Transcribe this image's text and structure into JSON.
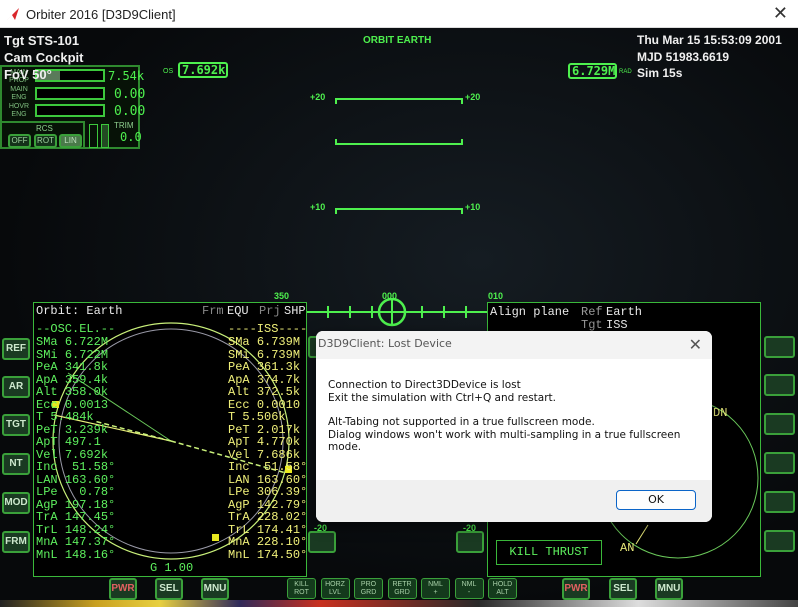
{
  "window": {
    "title": "Orbiter 2016 [D3D9Client]",
    "close": "✕"
  },
  "hud": {
    "target": "Tgt  STS-101",
    "camera": "Cam Cockpit",
    "fov": "FoV  50°",
    "mode": "ORBIT EARTH",
    "os_label": "OS",
    "os_value": "7.692k",
    "rad_value": "6.729M",
    "rad_label": "RAD",
    "date": "Thu Mar 15 15:53:09 2001",
    "mjd": "MJD  51983.6619",
    "sim": "Sim   15s",
    "ladder": [
      "+20",
      "+20",
      "+10",
      "+10",
      "-20",
      "-20"
    ],
    "heading": [
      "350",
      "000",
      "010"
    ]
  },
  "engine_panel": {
    "prop_label": "MAIN PROP",
    "prop_value": "7.54k",
    "prop_fill": 0.35,
    "main_label": "MAIN ENG",
    "main_value": "0.00",
    "hovr_label": "HOVR ENG",
    "hovr_value": "0.00",
    "rcs_label": "RCS",
    "rcs_buttons": [
      "OFF",
      "ROT",
      "LIN"
    ],
    "trim_label": "TRIM",
    "trim_value": "0.0"
  },
  "left_mfd": {
    "title": "Orbit: Earth",
    "frm_label": "Frm",
    "frm": "EQU",
    "prj_label": "Prj",
    "prj": "SHP",
    "left_header": "--OSC.EL.--",
    "right_header": "----ISS----",
    "own": [
      [
        "SMa",
        "6.722M"
      ],
      [
        "SMi",
        "6.722M"
      ],
      [
        "PeA",
        "341.8k"
      ],
      [
        "ApA",
        "359.4k"
      ],
      [
        "Alt",
        "358.0k"
      ],
      [
        "Ecc",
        "0.0013"
      ],
      [
        "T",
        "5.484k"
      ],
      [
        "PeT",
        "3.239k"
      ],
      [
        "ApT",
        "497.1"
      ],
      [
        "Vel",
        "7.692k"
      ],
      [
        "Inc",
        " 51.58°"
      ],
      [
        "LAN",
        "163.60°"
      ],
      [
        "LPe",
        "  0.78°"
      ],
      [
        "AgP",
        "197.18°"
      ],
      [
        "TrA",
        "147.45°"
      ],
      [
        "TrL",
        "148.24°"
      ],
      [
        "MnA",
        "147.37°"
      ],
      [
        "MnL",
        "148.16°"
      ]
    ],
    "target": [
      [
        "SMa",
        "6.739M"
      ],
      [
        "SMi",
        "6.739M"
      ],
      [
        "PeA",
        "361.3k"
      ],
      [
        "ApA",
        "374.7k"
      ],
      [
        "Alt",
        "372.5k"
      ],
      [
        "Ecc",
        "0.0010"
      ],
      [
        "T",
        "5.506k"
      ],
      [
        "PeT",
        "2.017k"
      ],
      [
        "ApT",
        "4.770k"
      ],
      [
        "Vel",
        "7.686k"
      ],
      [
        "Inc",
        " 51.58°"
      ],
      [
        "LAN",
        "163.60°"
      ],
      [
        "LPe",
        "306.39°"
      ],
      [
        "AgP",
        "142.79°"
      ],
      [
        "TrA",
        "228.02°"
      ],
      [
        "TrL",
        "174.41°"
      ],
      [
        "MnA",
        "228.10°"
      ],
      [
        "MnL",
        "174.50°"
      ]
    ],
    "footer": "G 1.00",
    "side_buttons": [
      "REF",
      "AR",
      "TGT",
      "NT",
      "MOD",
      "FRM"
    ],
    "bottom_buttons": [
      "PWR",
      "SEL",
      "MNU"
    ]
  },
  "right_mfd": {
    "title": "Align plane",
    "ref_label": "Ref",
    "ref": "Earth",
    "tgt_label": "Tgt",
    "tgt": "ISS",
    "dn": "DN",
    "an": "AN",
    "kill_thrust": "KILL THRUST",
    "bottom_buttons": [
      "PWR",
      "SEL",
      "MNU"
    ]
  },
  "nav_buttons": [
    [
      "KILL",
      "ROT"
    ],
    [
      "HORZ",
      "LVL"
    ],
    [
      "PRO",
      "GRD"
    ],
    [
      "RETR",
      "GRD"
    ],
    [
      "NML",
      "+"
    ],
    [
      "NML",
      "-"
    ],
    [
      "HOLD",
      "ALT"
    ]
  ],
  "dialog": {
    "title": "D3D9Client: Lost Device",
    "line1": "Connection to Direct3DDevice is lost",
    "line2": "Exit the simulation with Ctrl+Q and restart.",
    "line3": "Alt-Tabing not supported in a true fullscreen mode.",
    "line4": "Dialog windows won't work with multi-sampling in a true fullscreen mode.",
    "ok": "OK",
    "close": "✕"
  }
}
